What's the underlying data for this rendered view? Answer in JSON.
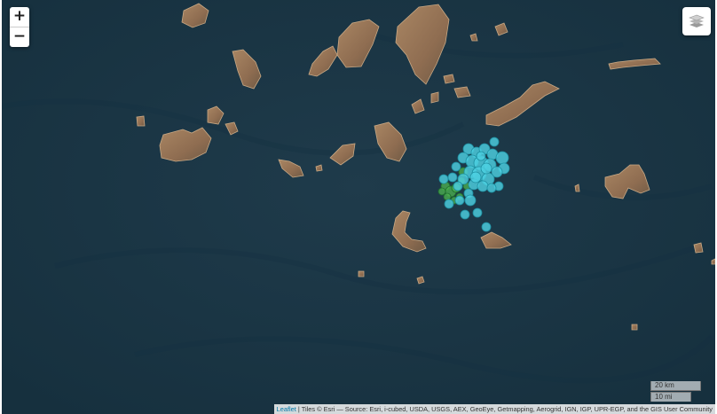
{
  "controls": {
    "zoom_in_label": "+",
    "zoom_out_label": "−"
  },
  "scale": {
    "metric_label": "20 km",
    "imperial_label": "10 mi"
  },
  "attribution": {
    "link_text": "Leaflet",
    "text": " | Tiles © Esri — Source: Esri, i-cubed, USDA, USGS, AEX, GeoEye, Getmapping, Aerogrid, IGN, IGP, UPR-EGP, and the GIS User Community"
  },
  "colors": {
    "sea": "#1b3443",
    "land": "#9c7b5c",
    "earthquake_recent": "#4dd0e1",
    "earthquake_older": "#4caf50"
  }
}
